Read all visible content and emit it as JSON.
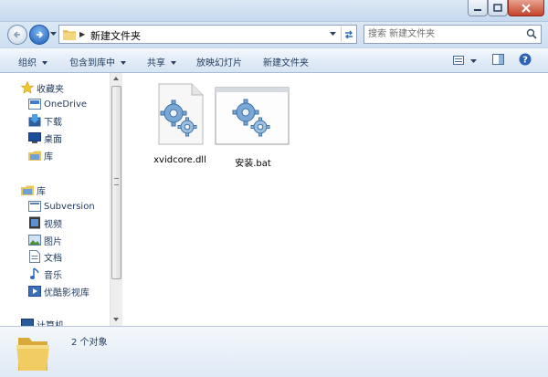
{
  "window": {
    "colors": {
      "accent": "#1b5db8",
      "close": "#c5432b",
      "toolbar": "#e2ecf7"
    }
  },
  "address": {
    "crumb": "新建文件夹"
  },
  "search": {
    "placeholder": "搜索 新建文件夹"
  },
  "toolbar": {
    "organize": "组织",
    "include_in_library": "包含到库中",
    "share": "共享",
    "slideshow": "放映幻灯片",
    "new_folder": "新建文件夹",
    "icons": [
      "view-icon",
      "preview-pane-icon",
      "help-icon"
    ]
  },
  "nav": {
    "favorites": "收藏夹",
    "onedrive": "OneDrive",
    "downloads": "下载",
    "desktop": "桌面",
    "library_fav": "库",
    "libraries": "库",
    "subversion": "Subversion",
    "videos": "视频",
    "pictures": "图片",
    "documents": "文档",
    "music": "音乐",
    "youku": "优酷影视库",
    "computer": "计算机"
  },
  "files": [
    {
      "name": "xvidcore.dll",
      "icon": "dll-gear-icon"
    },
    {
      "name": "安装.bat",
      "icon": "bat-gear-icon"
    }
  ],
  "details": {
    "count": "2 个对象"
  }
}
